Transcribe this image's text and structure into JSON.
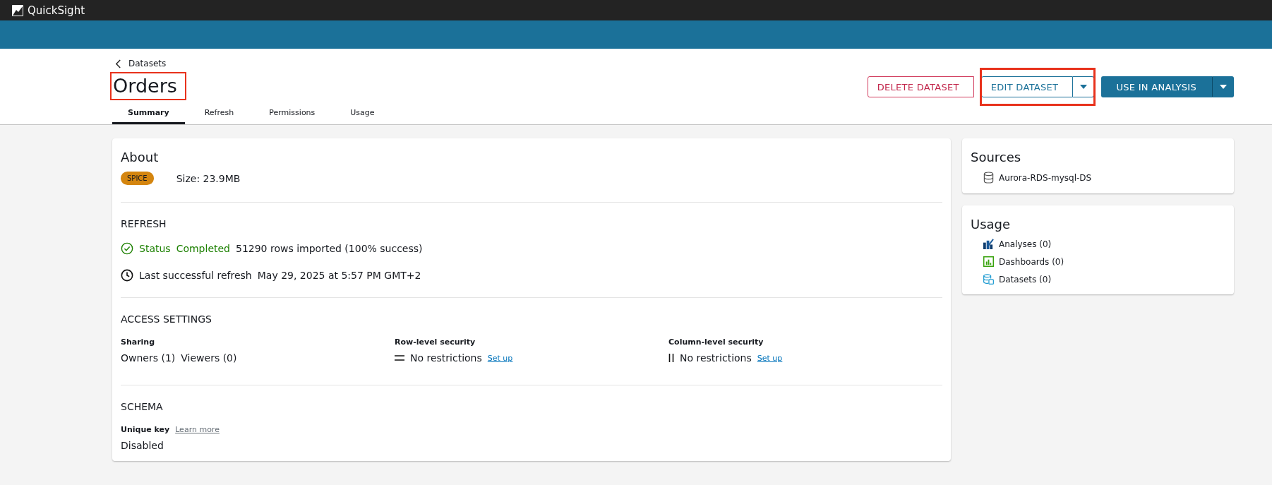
{
  "app": {
    "name": "QuickSight"
  },
  "breadcrumb": {
    "label": "Datasets"
  },
  "title": {
    "text": "Orders",
    "highlighted": true
  },
  "actions": [
    {
      "label": "DELETE DATASET",
      "kind": "danger",
      "has_dropdown": false,
      "highlighted": false
    },
    {
      "label": "EDIT DATASET",
      "kind": "secondary",
      "has_dropdown": true,
      "highlighted": true
    },
    {
      "label": "USE IN ANALYSIS",
      "kind": "primary",
      "has_dropdown": true,
      "highlighted": false
    }
  ],
  "tabs": [
    {
      "label": "Summary",
      "selected": true
    },
    {
      "label": "Refresh",
      "selected": false
    },
    {
      "label": "Permissions",
      "selected": false
    },
    {
      "label": "Usage",
      "selected": false
    }
  ],
  "about": {
    "title": "About",
    "badge": "SPICE",
    "size": "Size: 23.9MB"
  },
  "refresh": {
    "heading": "REFRESH",
    "status_label": "Status",
    "status": "Completed",
    "rows": "51290 rows imported (100% success)",
    "last_label": "Last successful refresh",
    "last_value": "May 29, 2025 at 5:57 PM GMT+2"
  },
  "access": {
    "heading": "ACCESS SETTINGS",
    "columns": [
      {
        "label": "Sharing",
        "kind": "sharing",
        "values": [
          "Owners (1)",
          "Viewers (0)"
        ]
      },
      {
        "label": "Row-level security",
        "kind": "row",
        "value": "No restrictions",
        "link": "Set up"
      },
      {
        "label": "Column-level security",
        "kind": "column",
        "value": "No restrictions",
        "link": "Set up"
      }
    ]
  },
  "schema": {
    "heading": "SCHEMA",
    "label": "Unique key",
    "link": "Learn more",
    "value": "Disabled"
  },
  "sources": {
    "title": "Sources",
    "items": [
      "Aurora-RDS-mysql-DS"
    ]
  },
  "usage": {
    "title": "Usage",
    "items": [
      {
        "label": "Analyses (0)",
        "kind": "analyses"
      },
      {
        "label": "Dashboards (0)",
        "kind": "dashboards"
      },
      {
        "label": "Datasets (0)",
        "kind": "datasets"
      }
    ]
  }
}
